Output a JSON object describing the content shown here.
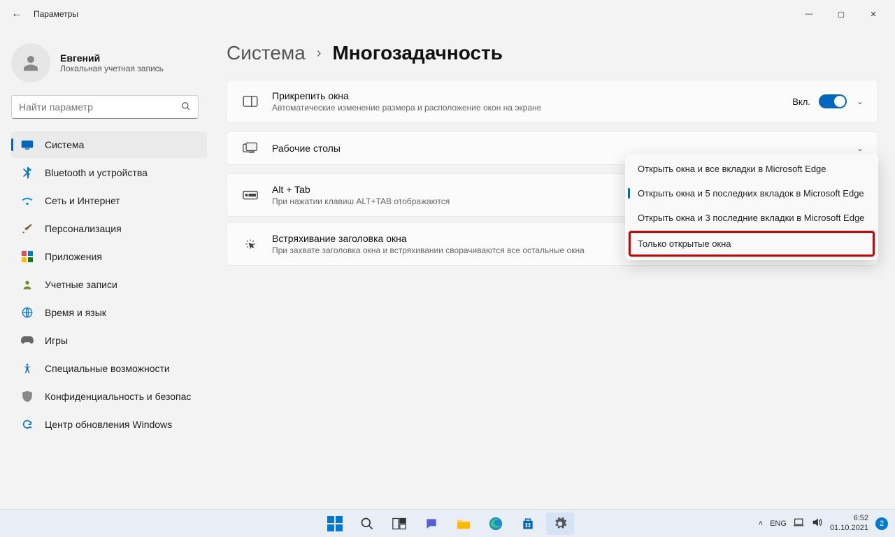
{
  "window": {
    "app_title": "Параметры"
  },
  "user": {
    "name": "Евгений",
    "subtitle": "Локальная учетная запись"
  },
  "search": {
    "placeholder": "Найти параметр"
  },
  "sidebar": {
    "items": [
      {
        "label": "Система",
        "active": true
      },
      {
        "label": "Bluetooth и устройства"
      },
      {
        "label": "Сеть и Интернет"
      },
      {
        "label": "Персонализация"
      },
      {
        "label": "Приложения"
      },
      {
        "label": "Учетные записи"
      },
      {
        "label": "Время и язык"
      },
      {
        "label": "Игры"
      },
      {
        "label": "Специальные возможности"
      },
      {
        "label": "Конфиденциальность и безопас"
      },
      {
        "label": "Центр обновления Windows"
      }
    ]
  },
  "breadcrumb": {
    "first": "Система",
    "second": "Многозадачность"
  },
  "rows": {
    "snap": {
      "title": "Прикрепить окна",
      "sub": "Автоматические изменение размера и расположение окон на экране",
      "state": "Вкл."
    },
    "desktops": {
      "title": "Рабочие столы"
    },
    "alttab": {
      "title": "Alt + Tab",
      "sub": "При нажатии клавиш ALT+TAB отображаются"
    },
    "shake": {
      "title": "Встряхивание заголовка окна",
      "sub": "При захвате заголовка окна и встряхивании сворачиваются все остальные окна"
    }
  },
  "dropdown": {
    "options": [
      "Открыть окна и все вкладки в Microsoft Edge",
      "Открыть окна и 5 последних вкладок в Microsoft Edge",
      "Открыть окна и 3 последние вкладки в Microsoft Edge",
      "Только открытые окна"
    ],
    "selected_index": 1,
    "highlighted_index": 3
  },
  "taskbar": {
    "lang": "ENG",
    "time": "6:52",
    "date": "01.10.2021",
    "notif": "2"
  }
}
